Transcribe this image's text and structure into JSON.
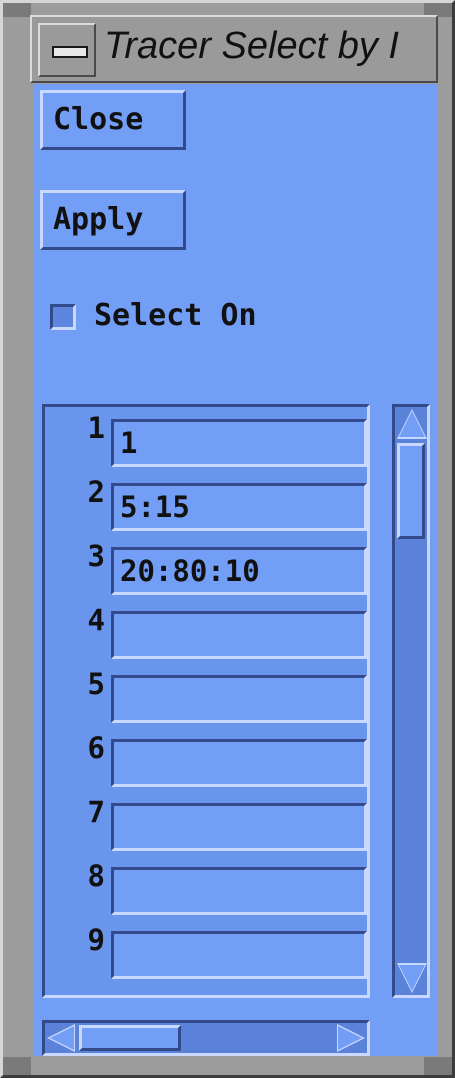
{
  "window": {
    "title": "Tracer Select by I",
    "menu_icon": "window-menu-icon"
  },
  "buttons": {
    "close_label": "Close",
    "apply_label": "Apply"
  },
  "toggle": {
    "label": "Select On",
    "checked": false
  },
  "list": {
    "rows": [
      {
        "index": "1",
        "value": "1"
      },
      {
        "index": "2",
        "value": "5:15"
      },
      {
        "index": "3",
        "value": "20:80:10"
      },
      {
        "index": "4",
        "value": ""
      },
      {
        "index": "5",
        "value": ""
      },
      {
        "index": "6",
        "value": ""
      },
      {
        "index": "7",
        "value": ""
      },
      {
        "index": "8",
        "value": ""
      },
      {
        "index": "9",
        "value": ""
      }
    ]
  },
  "colors": {
    "client_bg": "#739ef5",
    "frame_bg": "#9c9c9c"
  }
}
